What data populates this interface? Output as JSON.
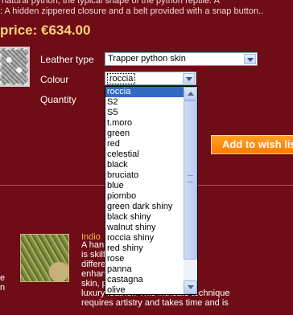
{
  "description": {
    "line1": "natural python, the typical shape of the python reptile. A",
    "line2": ": A hidden zippered closure and a belt provided with a snap button.."
  },
  "price": "price: €634.00",
  "form": {
    "leather_type_label": "Leather type",
    "leather_type_value": "Trapper python skin",
    "colour_label": "Colour",
    "colour_value": "roccia",
    "quantity_label": "Quantity"
  },
  "colour_options": [
    "roccia",
    "S2",
    "S5",
    "t.moro",
    "green",
    "red",
    "celestial",
    "black",
    "bruciato",
    "blue",
    "piombo",
    "green dark shiny",
    "black shiny",
    "walnut shiny",
    "roccia shiny",
    "red shiny",
    "rose",
    "panna",
    "castagna",
    "olive"
  ],
  "wish_button": "Add to wish list",
  "bottom": {
    "left_e": "e",
    "left_n": "n",
    "title": "Indio",
    "desc_lines": [
      "A han         each python skin",
      "is skilf      ast three",
      "differe       h highlight and",
      "enhan         of the python",
      "skin, p       y elegant,",
      "luxury leather. This intricate technique",
      "requires artistry and takes time and is"
    ]
  }
}
